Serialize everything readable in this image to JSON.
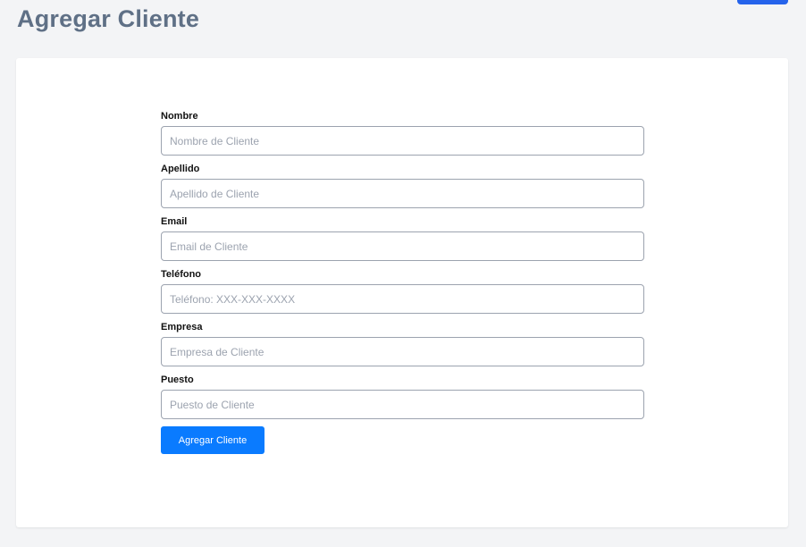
{
  "header": {
    "title": "Agregar Cliente"
  },
  "form": {
    "fields": [
      {
        "label": "Nombre",
        "placeholder": "Nombre de Cliente",
        "value": ""
      },
      {
        "label": "Apellido",
        "placeholder": "Apellido de Cliente",
        "value": ""
      },
      {
        "label": "Email",
        "placeholder": "Email de Cliente",
        "value": ""
      },
      {
        "label": "Teléfono",
        "placeholder": "Teléfono: XXX-XXX-XXXX",
        "value": ""
      },
      {
        "label": "Empresa",
        "placeholder": "Empresa de Cliente",
        "value": ""
      },
      {
        "label": "Puesto",
        "placeholder": "Puesto de Cliente",
        "value": ""
      }
    ],
    "submit_label": "Agregar Cliente"
  },
  "colors": {
    "accent": "#0a7bff",
    "top_button": "#2563eb",
    "title": "#5f7086",
    "background": "#f3f4f6"
  }
}
